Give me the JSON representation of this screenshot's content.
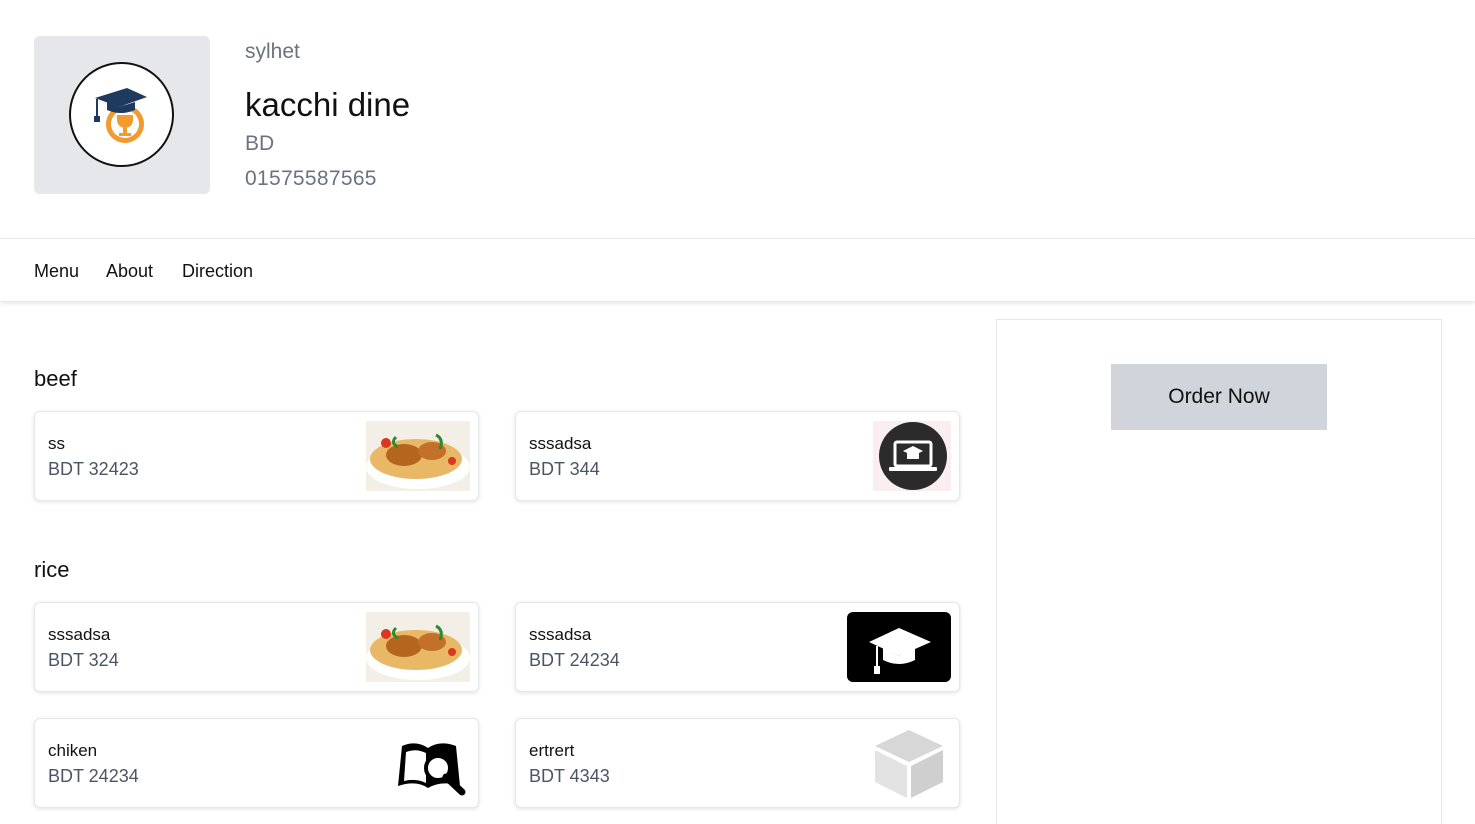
{
  "restaurant": {
    "city": "sylhet",
    "name": "kacchi dine",
    "country": "BD",
    "phone": "01575587565",
    "logo_icon": "graduation-trophy-logo"
  },
  "nav": {
    "items": [
      {
        "label": "Menu"
      },
      {
        "label": "About"
      },
      {
        "label": "Direction"
      }
    ]
  },
  "menu": {
    "sections": [
      {
        "title": "beef",
        "items": [
          {
            "name": "ss",
            "price": "BDT 32423",
            "image": "biryani-photo"
          },
          {
            "name": "sssadsa",
            "price": "BDT 344",
            "image": "laptop-graduation-icon"
          }
        ]
      },
      {
        "title": "rice",
        "items": [
          {
            "name": "sssadsa",
            "price": "BDT 324",
            "image": "biryani-photo"
          },
          {
            "name": "sssadsa",
            "price": "BDT 24234",
            "image": "graduation-cap-icon"
          },
          {
            "name": "chiken",
            "price": "BDT 24234",
            "image": "book-search-icon"
          },
          {
            "name": "ertrert",
            "price": "BDT 4343",
            "image": "box-icon"
          }
        ]
      }
    ]
  },
  "sidebar": {
    "order_button": "Order Now"
  },
  "colors": {
    "logo_bg": "#e5e7eb",
    "muted_text": "#6b7280",
    "price_text": "#4b5563",
    "button_bg": "#d1d5db",
    "accent_orange": "#f29a2e",
    "accent_navy": "#1f3a5f"
  }
}
